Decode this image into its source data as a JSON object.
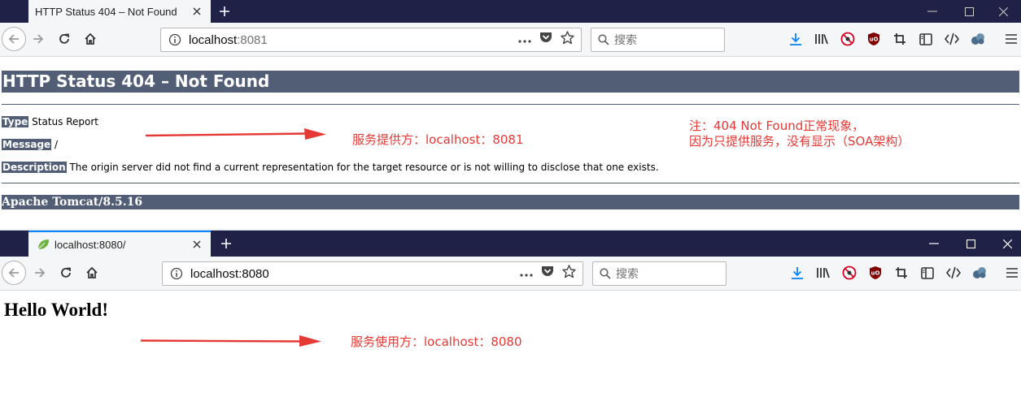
{
  "window1": {
    "tab_title": "HTTP Status 404 – Not Found",
    "url_host": "localhost",
    "url_port": ":8081",
    "search_placeholder": "搜索",
    "page": {
      "heading": "HTTP Status 404 – Not Found",
      "type_label": "Type",
      "type_value": "Status Report",
      "message_label": "Message",
      "message_value": "/",
      "description_label": "Description",
      "description_value": "The origin server did not find a current representation for the target resource or is not willing to disclose that one exists.",
      "footer": "Apache Tomcat/8.5.16"
    },
    "annotations": {
      "provider": "服务提供方：localhost：8081",
      "note_line1": "注：404 Not Found正常现象，",
      "note_line2": "因为只提供服务，没有显示（SOA架构）"
    }
  },
  "window2": {
    "tab_title": "localhost:8080/",
    "url_host": "localhost:8080",
    "url_port": "",
    "search_placeholder": "搜索",
    "page": {
      "heading": "Hello World!"
    },
    "annotations": {
      "consumer": "服务使用方：localhost：8080"
    }
  },
  "colors": {
    "tab_strip": "#1f2146",
    "tomcat_bar": "#525d76",
    "annotation_red": "#e53935",
    "active_tab_accent": "#0a84ff"
  },
  "icons": [
    "back-icon",
    "forward-icon",
    "reload-icon",
    "home-icon",
    "info-icon",
    "more-icon",
    "pocket-icon",
    "star-icon",
    "search-icon",
    "download-icon",
    "library-icon",
    "tracker-block-icon",
    "ublock-icon",
    "crop-icon",
    "sidebar-icon",
    "devtools-icon",
    "extension-icon",
    "menu-icon",
    "close-icon",
    "plus-icon",
    "minimize-icon",
    "maximize-icon",
    "leaf-icon"
  ]
}
